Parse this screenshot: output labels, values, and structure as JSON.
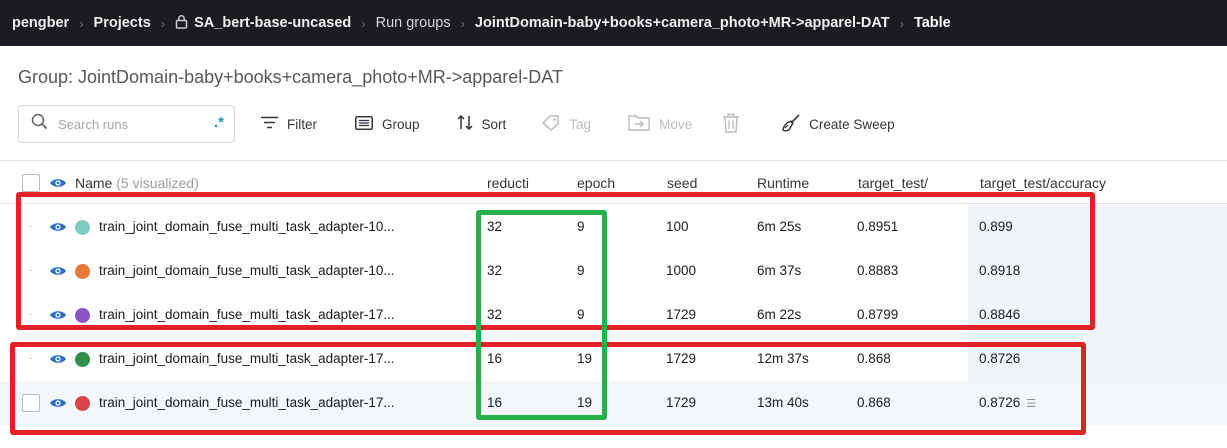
{
  "breadcrumb": {
    "user": "pengber",
    "projects": "Projects",
    "project": "SA_bert-base-uncased",
    "run_groups": "Run groups",
    "group": "JointDomain-baby+books+camera_photo+MR->apparel-DAT",
    "current": "Table"
  },
  "page_title": "Group: JointDomain-baby+books+camera_photo+MR->apparel-DAT",
  "toolbar": {
    "search_placeholder": "Search runs",
    "regex_label": ".*",
    "filter": "Filter",
    "group": "Group",
    "sort": "Sort",
    "tag": "Tag",
    "move": "Move",
    "create_sweep": "Create Sweep"
  },
  "table": {
    "headers": {
      "name": "Name",
      "name_sub": "(5 visualized)",
      "reduction": "reducti",
      "epoch": "epoch",
      "seed": "seed",
      "runtime": "Runtime",
      "target_test": "target_test/",
      "accuracy": "target_test/accuracy"
    },
    "rows": [
      {
        "name": "train_joint_domain_fuse_multi_task_adapter-10...",
        "color": "#7fcbc0",
        "reduction": "32",
        "epoch": "9",
        "seed": "100",
        "runtime": "6m 25s",
        "target_test": "0.8951",
        "accuracy": "0.899"
      },
      {
        "name": "train_joint_domain_fuse_multi_task_adapter-10...",
        "color": "#e8793a",
        "reduction": "32",
        "epoch": "9",
        "seed": "1000",
        "runtime": "6m 37s",
        "target_test": "0.8883",
        "accuracy": "0.8918"
      },
      {
        "name": "train_joint_domain_fuse_multi_task_adapter-17...",
        "color": "#8a54c4",
        "reduction": "32",
        "epoch": "9",
        "seed": "1729",
        "runtime": "6m 22s",
        "target_test": "0.8799",
        "accuracy": "0.8846"
      },
      {
        "name": "train_joint_domain_fuse_multi_task_adapter-17...",
        "color": "#2f8f4e",
        "reduction": "16",
        "epoch": "19",
        "seed": "1729",
        "runtime": "12m 37s",
        "target_test": "0.868",
        "accuracy": "0.8726"
      },
      {
        "name": "train_joint_domain_fuse_multi_task_adapter-17...",
        "color": "#d9434a",
        "reduction": "16",
        "epoch": "19",
        "seed": "1729",
        "runtime": "13m 40s",
        "target_test": "0.868",
        "accuracy": "0.8726"
      }
    ]
  },
  "colors": {
    "annotation_red": "#e32227",
    "annotation_green": "#27b04a",
    "topbar": "#1a1c1f",
    "accent": "#1d9aa6"
  }
}
